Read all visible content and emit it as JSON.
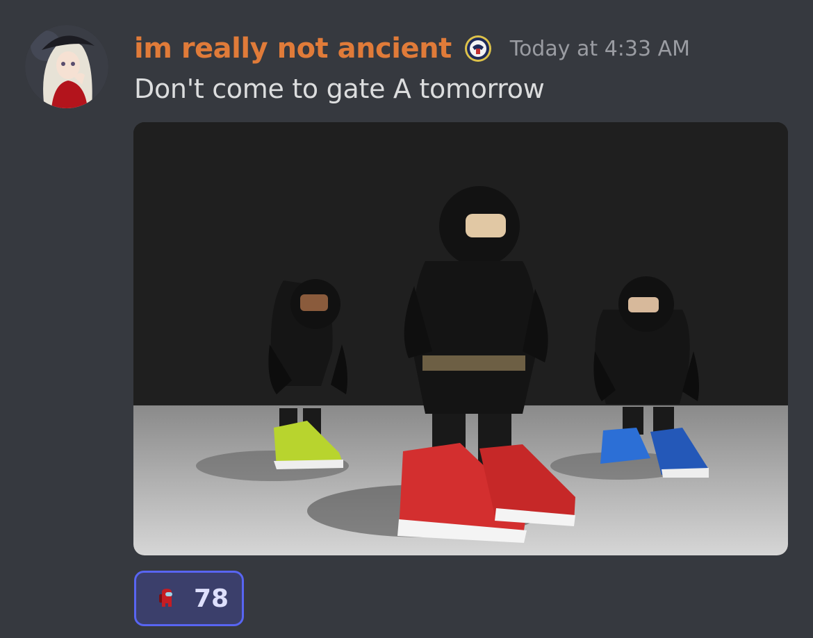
{
  "message": {
    "author": {
      "username": "im really not ancient",
      "username_color": "#e07b39",
      "avatar": "anime-girl-avatar",
      "badge": "server-emblem-icon"
    },
    "timestamp": "Today at 4:33 AM",
    "content": "Don't come to gate A tomorrow",
    "attachment": {
      "type": "image",
      "depicts": "three-armored-roblox-characters-in-sneakers"
    },
    "reactions": [
      {
        "emoji": "red-crewmate-icon",
        "count": "78",
        "selected": true
      }
    ]
  },
  "colors": {
    "background": "#36393f",
    "text": "#dcddde",
    "timestamp": "#9a9ca2",
    "reaction_border": "#5865f2",
    "reaction_bg": "#3b3f6b"
  }
}
